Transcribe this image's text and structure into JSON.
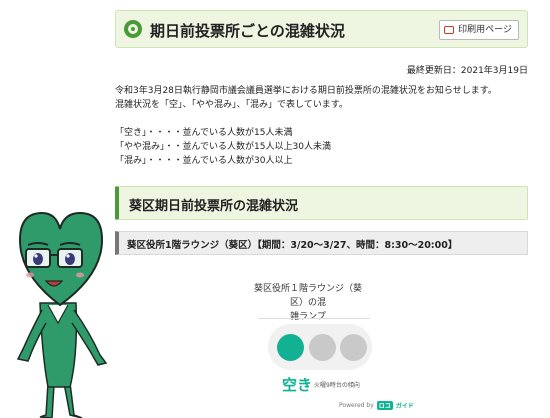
{
  "header": {
    "title": "期日前投票所ごとの混雑状況",
    "print_label": "印刷用ページ"
  },
  "updated": "最終更新日：2021年3月19日",
  "intro": [
    "令和3年3月28日執行静岡市議会議員選挙における期日前投票所の混雑状況をお知らせします。",
    "混雑状況を「空」、「やや混み」、「混み」で表しています。"
  ],
  "levels": [
    "「空き」・・・・並んでいる人数が15人未満",
    "「やや混み」・・並んでいる人数が15人以上30人未満",
    "「混み」・・・・並んでいる人数が30人以上"
  ],
  "section": {
    "title": "葵区期日前投票所の混雑状況"
  },
  "venue": {
    "text": "葵区役所1階ラウンジ（葵区）【期間：3/20～3/27、時間：8:30～20:00】"
  },
  "widget": {
    "title_line1": "葵区役所１階ラウンジ（葵区）の混",
    "title_line2": "雑ランプ",
    "status": "空き",
    "status_note": "火曜9時台の傾向",
    "powered_by": "Powered by",
    "brand_a": "ロコ",
    "brand_b": "ガイド",
    "active_level": 1,
    "active_color": "#12b193",
    "inactive_color": "#c9c9c9"
  },
  "colors": {
    "accent_green": "#4a9a3a",
    "header_bg": "#eef6e2",
    "mascot_green": "#2f9a6a"
  }
}
